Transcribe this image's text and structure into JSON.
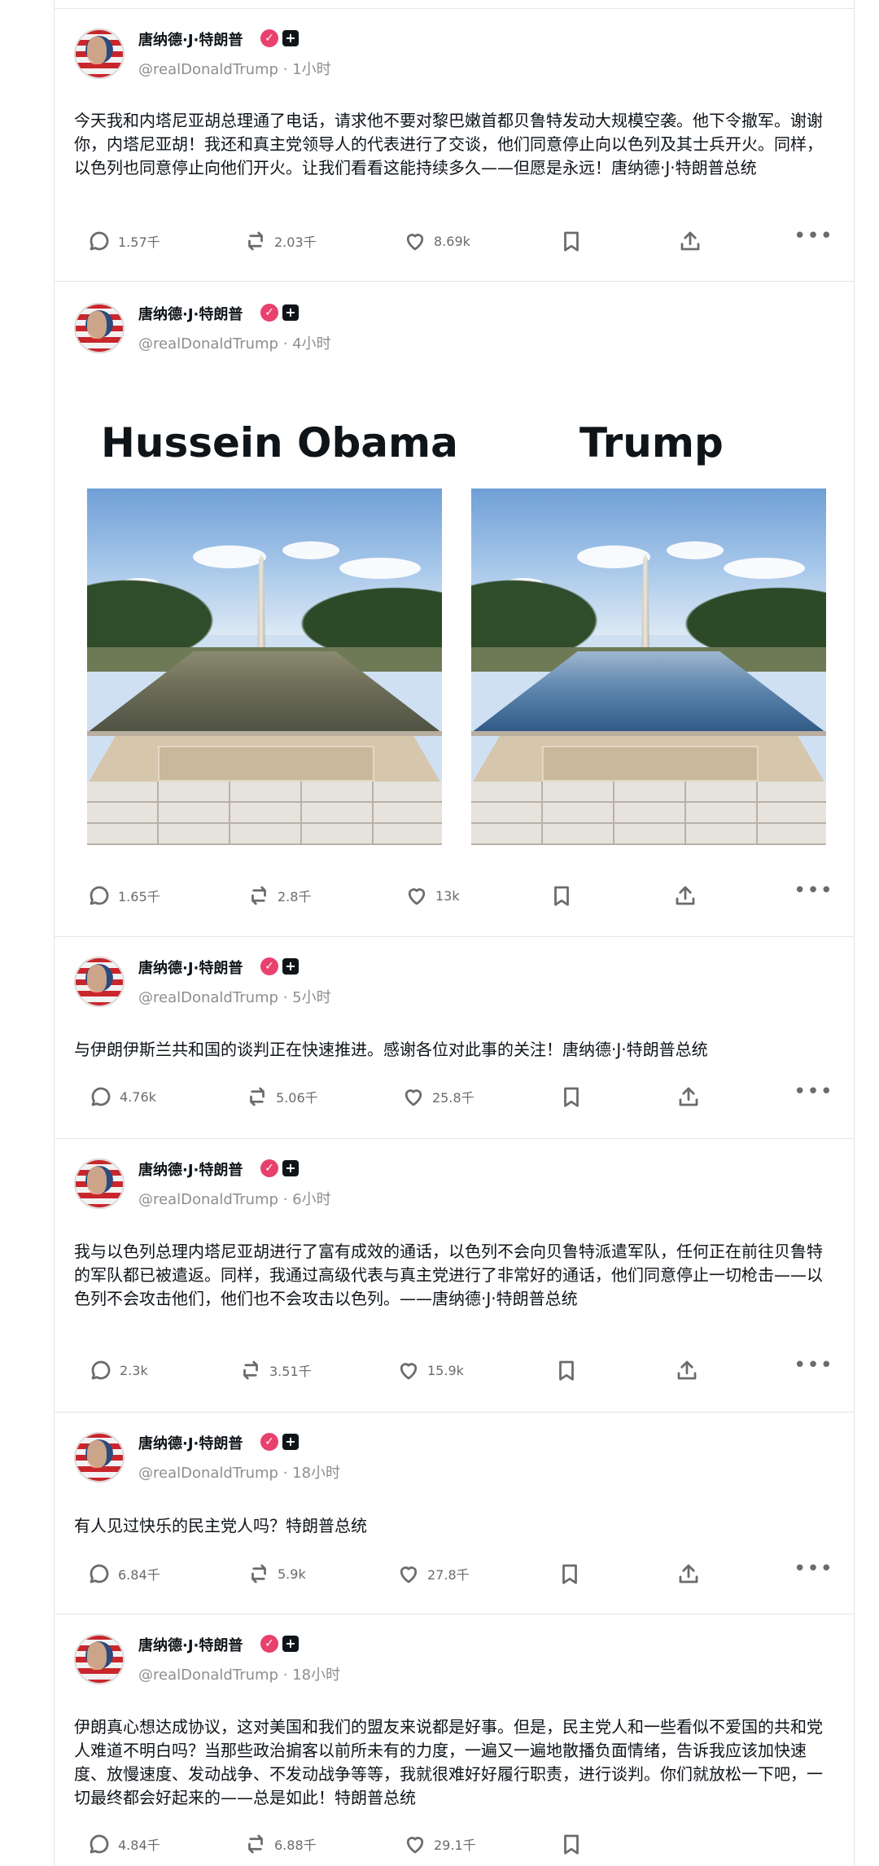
{
  "posts": [
    {
      "name": "唐纳德·J·特朗普",
      "handle": "@realDonaldTrump · 1小时",
      "text": "今天我和内塔尼亚胡总理通了电话，请求他不要对黎巴嫩首都贝鲁特发动大规模空袭。他下令撤军。谢谢你，内塔尼亚胡！我还和真主党领导人的代表进行了交谈，他们同意停止向以色列及其士兵开火。同样，以色列也同意停止向他们开火。让我们看看这能持续多久——但愿是永远！唐纳德·J·特朗普总统",
      "replies": "1.57千",
      "reposts": "2.03千",
      "likes": "8.69k"
    },
    {
      "name": "唐纳德·J·特朗普",
      "handle": "@realDonaldTrump · 4小时",
      "text": "",
      "image": {
        "left_title": "Hussein Obama",
        "right_title": "Trump"
      },
      "replies": "1.65千",
      "reposts": "2.8千",
      "likes": "13k"
    },
    {
      "name": "唐纳德·J·特朗普",
      "handle": "@realDonaldTrump · 5小时",
      "text": "与伊朗伊斯兰共和国的谈判正在快速推进。感谢各位对此事的关注！唐纳德·J·特朗普总统",
      "replies": "4.76k",
      "reposts": "5.06千",
      "likes": "25.8千"
    },
    {
      "name": "唐纳德·J·特朗普",
      "handle": "@realDonaldTrump · 6小时",
      "text": "我与以色列总理内塔尼亚胡进行了富有成效的通话，以色列不会向贝鲁特派遣军队，任何正在前往贝鲁特的军队都已被遣返。同样，我通过高级代表与真主党进行了非常好的通话，他们同意停止一切枪击——以色列不会攻击他们，他们也不会攻击以色列。——唐纳德·J·特朗普总统",
      "replies": "2.3k",
      "reposts": "3.51千",
      "likes": "15.9k"
    },
    {
      "name": "唐纳德·J·特朗普",
      "handle": "@realDonaldTrump · 18小时",
      "text": "有人见过快乐的民主党人吗？特朗普总统",
      "replies": "6.84千",
      "reposts": "5.9k",
      "likes": "27.8千"
    },
    {
      "name": "唐纳德·J·特朗普",
      "handle": "@realDonaldTrump · 18小时",
      "text": "伊朗真心想达成协议，这对美国和我们的盟友来说都是好事。但是，民主党人和一些看似不爱国的共和党人难道不明白吗？当那些政治掮客以前所未有的力度，一遍又一遍地散播负面情绪，告诉我应该加快速度、放慢速度、发动战争、不发动战争等等，我就很难好好履行职责，进行谈判。你们就放松一下吧，一切最终都会好起来的——总是如此！特朗普总统",
      "replies": "4.84千",
      "reposts": "6.88千",
      "likes": "29.1千"
    }
  ],
  "icons": {
    "verified": "verified-badge-icon",
    "plus": "plus-badge-icon",
    "reply": "comment-bubble-icon",
    "repost": "repost-arrows-icon",
    "like": "heart-icon",
    "bookmark": "bookmark-icon",
    "share": "share-upload-icon",
    "more": "more-dots-icon"
  },
  "colors": {
    "verified": "#e8416e",
    "text": "#0f1419",
    "muted": "#6b6b6b",
    "divider": "#e6e6e6"
  }
}
